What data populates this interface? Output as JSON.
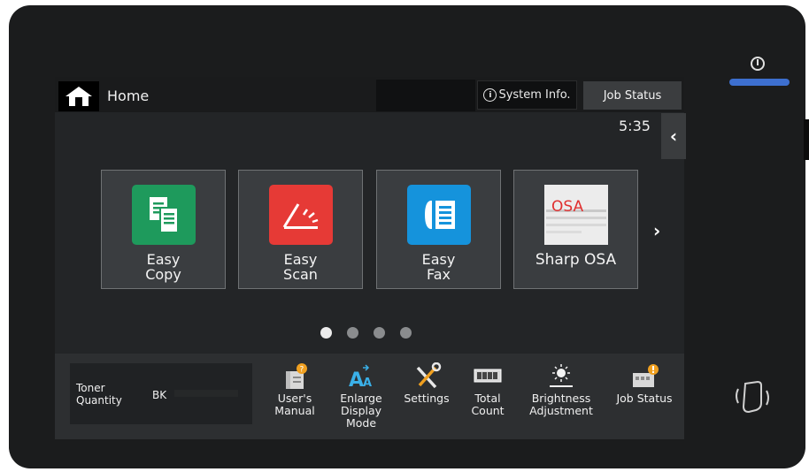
{
  "header": {
    "home_label": "Home",
    "system_info_label": "System Info.",
    "job_status_label": "Job Status",
    "time": "5:35"
  },
  "tiles": [
    {
      "label_line1": "Easy",
      "label_line2": "Copy",
      "icon": "copy-icon",
      "color": "#1e9a5c"
    },
    {
      "label_line1": "Easy",
      "label_line2": "Scan",
      "icon": "scan-icon",
      "color": "#e63a36"
    },
    {
      "label_line1": "Easy",
      "label_line2": "Fax",
      "icon": "fax-icon",
      "color": "#1593dc"
    },
    {
      "label": "Sharp OSA",
      "icon_text": "OSA",
      "icon": "osa-icon"
    }
  ],
  "pager": {
    "count": 4,
    "active": 1
  },
  "toner": {
    "label_line1": "Toner",
    "label_line2": "Quantity",
    "bk_label": "BK"
  },
  "bottom_items": [
    {
      "lines": [
        "User's",
        "Manual"
      ],
      "icon": "manual-icon"
    },
    {
      "lines": [
        "Enlarge",
        "Display",
        "Mode"
      ],
      "icon": "enlarge-icon"
    },
    {
      "lines": [
        "Settings"
      ],
      "icon": "settings-icon"
    },
    {
      "lines": [
        "Total",
        "Count"
      ],
      "icon": "counter-icon"
    },
    {
      "lines": [
        "Brightness",
        "Adjustment"
      ],
      "icon": "brightness-icon"
    },
    {
      "lines": [
        "Job Status"
      ],
      "icon": "job-status-icon"
    }
  ],
  "colors": {
    "led": "#3d6fcf",
    "badge": "#f0a020"
  }
}
